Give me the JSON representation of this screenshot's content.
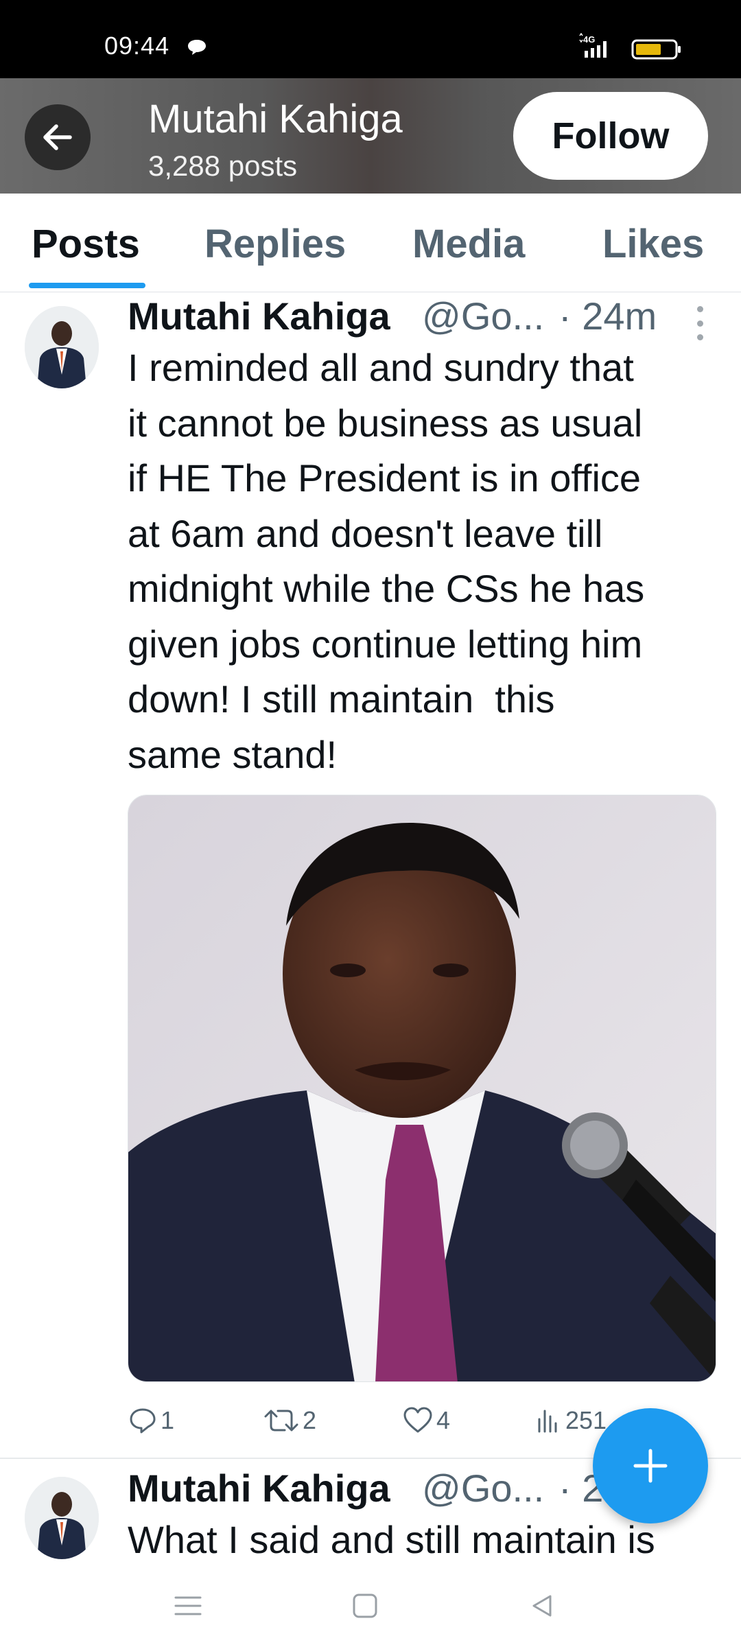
{
  "status_bar": {
    "time": "09:44",
    "network": "4G",
    "battery_color": "#e5b80b"
  },
  "header": {
    "back_icon": "arrow-left-icon",
    "title": "Mutahi Kahiga",
    "post_count": "3,288 posts",
    "follow_label": "Follow"
  },
  "tabs": [
    {
      "label": "Posts",
      "active": true
    },
    {
      "label": "Replies",
      "active": false
    },
    {
      "label": "Media",
      "active": false
    },
    {
      "label": "Likes",
      "active": false
    }
  ],
  "accent_color": "#1d9bf0",
  "posts": [
    {
      "name": "Mutahi Kahiga",
      "handle": "@Go...",
      "time": "· 24m",
      "text_lines": [
        "I reminded all and sundry that",
        "it cannot be business as usual",
        "if HE The President is in office",
        "at 6am and doesn't leave till",
        "midnight while the CSs he has",
        "given jobs continue letting him",
        "down! I still maintain  this",
        "same stand!"
      ],
      "stats": {
        "replies": "1",
        "reposts": "2",
        "likes": "4",
        "views": "251"
      }
    },
    {
      "name": "Mutahi Kahiga",
      "handle": "@Go...",
      "time": "· 2",
      "text_first_line": "What I said and still maintain is"
    }
  ],
  "fab_icon": "plus-icon",
  "nav": {
    "menu_icon": "menu-icon",
    "home_icon": "square-home-icon",
    "back_icon": "triangle-back-icon"
  }
}
